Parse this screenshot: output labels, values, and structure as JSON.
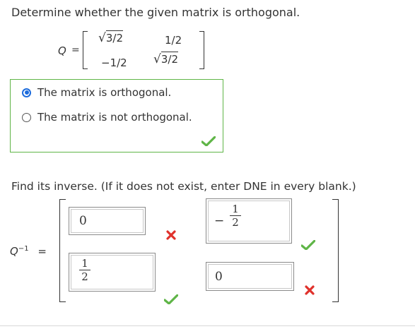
{
  "question": {
    "prompt": "Determine whether the given matrix is orthogonal.",
    "matrix_label": "Q",
    "equals": "=",
    "matrix": {
      "r1c1": "3/2",
      "r1c2": "1/2",
      "r2c1": "−1/2",
      "r2c2": "3/2",
      "sqrt_symbol": "√"
    },
    "options": [
      {
        "label": "The matrix is orthogonal.",
        "selected": true
      },
      {
        "label": "The matrix is not orthogonal.",
        "selected": false
      }
    ],
    "result": "correct"
  },
  "inverse": {
    "prompt": "Find its inverse. (If it does not exist, enter DNE in every blank.)",
    "label_base": "Q",
    "label_sup": "−1",
    "equals": "=",
    "cells": [
      {
        "kind": "text",
        "value": "0",
        "result": "incorrect"
      },
      {
        "kind": "fraction",
        "sign": "−",
        "numerator": "1",
        "denominator": "2",
        "result": "correct"
      },
      {
        "kind": "fraction",
        "sign": "",
        "numerator": "1",
        "denominator": "2",
        "result": "correct"
      },
      {
        "kind": "text",
        "value": "0",
        "result": "incorrect"
      }
    ]
  },
  "colors": {
    "correct": "#5fb547",
    "incorrect": "#e0312b",
    "radio_selected": "#1c6bdc",
    "border_correct": "#5fb547"
  },
  "icons": {
    "correct": "check-icon",
    "incorrect": "x-icon"
  }
}
